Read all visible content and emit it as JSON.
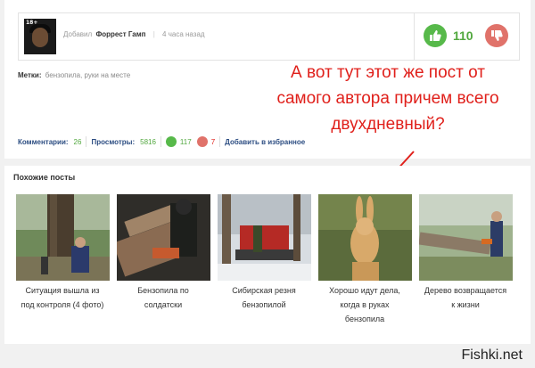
{
  "post": {
    "avatar_badge": "18+",
    "author_prefix": "Добавил",
    "author_name": "Форрест Гамп",
    "posted_time": "4 часа назад",
    "vote_score": "110",
    "tags_label": "Метки:",
    "tags": [
      "бензопила",
      "руки на месте"
    ],
    "tags_separator": ","
  },
  "stats": {
    "comments_label": "Комментарии:",
    "comments_value": "26",
    "views_label": "Просмотры:",
    "views_value": "5816",
    "likes_value": "117",
    "dislikes_value": "7",
    "favorite_label": "Добавить в избранное"
  },
  "annotation": {
    "lines": [
      "А вот тут этот же пост от",
      "самого автора причем всего",
      "двухдневный?"
    ],
    "color": "#e0201b"
  },
  "similar": {
    "title": "Похожие посты",
    "items": [
      {
        "caption_lines": [
          "Ситуация вышла из",
          "под контроля (4 фото)"
        ]
      },
      {
        "caption_lines": [
          "Бензопила по",
          "солдатски"
        ]
      },
      {
        "caption_lines": [
          "Сибирская резня",
          "бензопилой"
        ]
      },
      {
        "caption_lines": [
          "Хорошо идут дела,",
          "когда в руках",
          "бензопила"
        ]
      },
      {
        "caption_lines": [
          "Дерево возвращается",
          "к жизни"
        ]
      }
    ]
  },
  "watermark": "Fishki.net",
  "colors": {
    "vote_up": "#57b94a",
    "vote_down": "#e0726a",
    "link_blue": "#2c4d82",
    "count_green": "#52a83f"
  }
}
